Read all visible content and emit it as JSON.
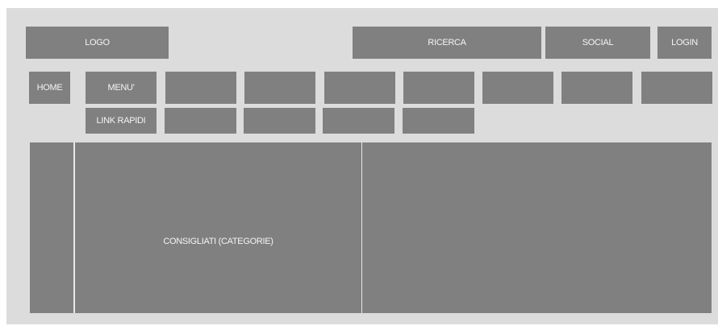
{
  "header": {
    "logo": "LOGO",
    "search": "RICERCA",
    "social": "SOCIAL",
    "login": "LOGIN"
  },
  "nav": {
    "home": "HOME",
    "menu": "MENU'",
    "quick_links": "LINK RAPIDI"
  },
  "main": {
    "recommended": "CONSIGLIATI (CATEGORIE)"
  },
  "colors": {
    "background": "#dcdcdd",
    "block": "#808080",
    "text": "#f4f4f4"
  }
}
